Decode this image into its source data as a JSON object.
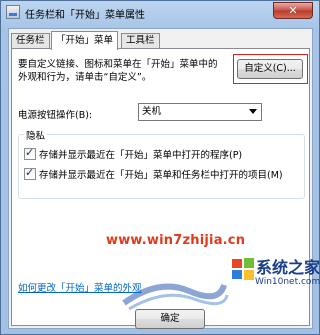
{
  "window": {
    "title": "任务栏和「开始」菜单属性",
    "close_label": "✕"
  },
  "tabs": [
    {
      "label": "任务栏",
      "active": false
    },
    {
      "label": "「开始」菜单",
      "active": true
    },
    {
      "label": "工具栏",
      "active": false
    }
  ],
  "panel": {
    "description_line1": "要自定义链接、图标和菜单在「开始」菜单中的",
    "description_line2": "外观和行为，请单击“自定义”。",
    "customize_button": "自定义(C)...",
    "power_label": "电源按钮操作(B):",
    "power_value": "关机",
    "privacy_title": "隐私",
    "privacy_items": [
      {
        "label": "存储并显示最近在「开始」菜单中打开的程序(P)",
        "checked": true
      },
      {
        "label": "存储并显示最近在「开始」菜单和任务栏中打开的项目(M)",
        "checked": true
      }
    ],
    "help_link": "如何更改「开始」菜单的外观"
  },
  "watermark": {
    "url": "www.win7zhijia.cn",
    "logo_text": "系统之家",
    "logo_sub": "Win10net.com"
  },
  "footer": {
    "ok_button": "确定"
  },
  "colors": {
    "accent_red": "#e0201a",
    "link_blue": "#0066cc"
  }
}
